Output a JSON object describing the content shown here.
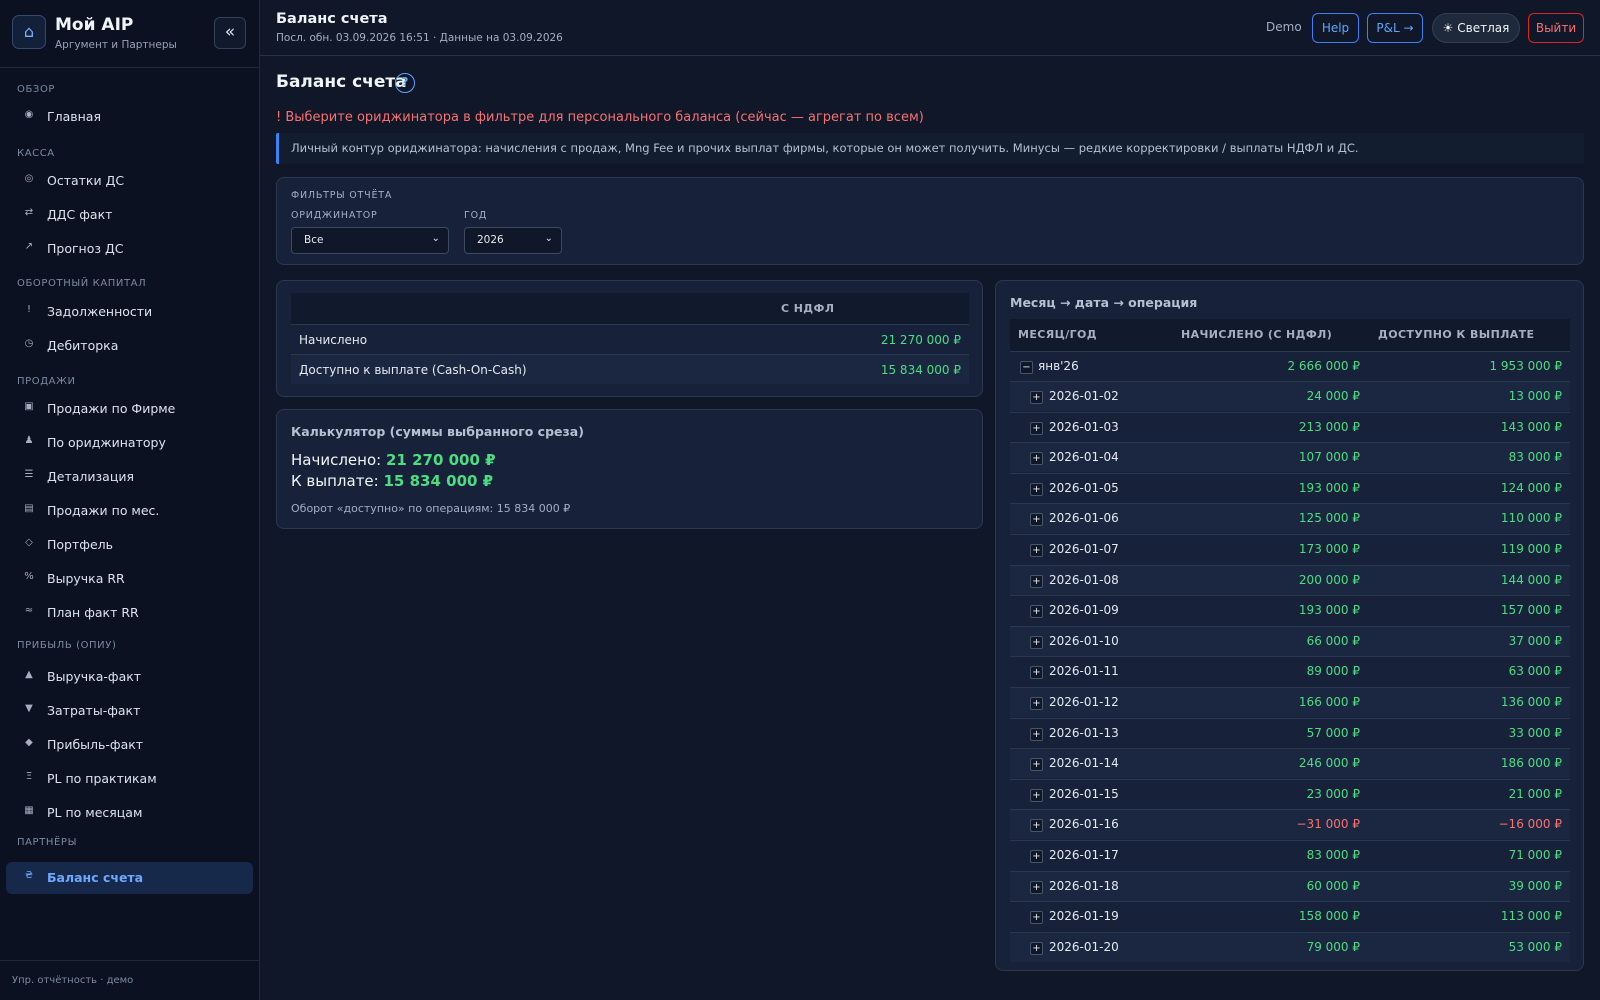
{
  "brand": {
    "logo_icon": "home-icon",
    "title": "Мой AIP",
    "subtitle": "Аргумент и Партнеры",
    "collapse": "«"
  },
  "sidebar": {
    "sections": [
      {
        "title": "ОБЗОР",
        "items": [
          {
            "icon": "◉",
            "label": "Главная"
          }
        ]
      },
      {
        "title": "КАССА",
        "items": [
          {
            "icon": "◎",
            "label": "Остатки ДС"
          },
          {
            "icon": "⇄",
            "label": "ДДС факт"
          },
          {
            "icon": "↗",
            "label": "Прогноз ДС"
          }
        ]
      },
      {
        "title": "ОБОРОТНЫЙ КАПИТАЛ",
        "items": [
          {
            "icon": "!",
            "label": "Задолженности"
          },
          {
            "icon": "◷",
            "label": "Дебиторка"
          }
        ]
      },
      {
        "title": "ПРОДАЖИ",
        "items": [
          {
            "icon": "▣",
            "label": "Продажи по Фирме"
          },
          {
            "icon": "♟",
            "label": "По ориджинатору"
          },
          {
            "icon": "☰",
            "label": "Детализация"
          },
          {
            "icon": "▤",
            "label": "Продажи по мес."
          },
          {
            "icon": "◇",
            "label": "Портфель"
          },
          {
            "icon": "%",
            "label": "Выручка RR"
          },
          {
            "icon": "≈",
            "label": "План факт RR"
          }
        ]
      },
      {
        "title": "ПРИБЫЛЬ (ОПИУ)",
        "items": [
          {
            "icon": "▲",
            "label": "Выручка-факт"
          },
          {
            "icon": "▼",
            "label": "Затраты-факт"
          },
          {
            "icon": "◆",
            "label": "Прибыль-факт"
          },
          {
            "icon": "Ξ",
            "label": "PL по практикам"
          },
          {
            "icon": "▦",
            "label": "PL по месяцам"
          }
        ]
      },
      {
        "title": "ПАРТНЁРЫ",
        "items": [
          {
            "icon": "₴",
            "label": "Баланс счета",
            "active": true
          }
        ]
      }
    ],
    "footer": "Упр. отчётность · демо"
  },
  "header": {
    "title": "Баланс счета",
    "subtitle": "Посл. обн. 03.09.2026 16:51 · Данные на 03.09.2026",
    "demo": "Demo",
    "help": "Help",
    "pl": "P&L →",
    "theme": "☀ Светлая",
    "logout": "Выйти"
  },
  "page": {
    "title": "Баланс счета",
    "help_icon": "?",
    "warning": "! Выберите ориджинатора в фильтре для персонального баланса (сейчас — агрегат по всем)",
    "info": "Личный контур ориджинатора: начисления с продаж, Mng Fee и прочих выплат фирмы, которые он может получить. Минусы — редкие корректировки / выплаты НДФЛ и ДС."
  },
  "filters": {
    "title": "ФИЛЬТРЫ ОТЧЁТА",
    "originator_label": "ОРИДЖИНАТОР",
    "originator_value": "Все",
    "year_label": "ГОД",
    "year_value": "2026"
  },
  "summary": {
    "col_header": "С НДФЛ",
    "rows": [
      {
        "label": "Начислено",
        "value": "21 270 000 ₽"
      },
      {
        "label": "Доступно к выплате (Cash-On-Cash)",
        "value": "15 834 000 ₽"
      }
    ]
  },
  "calculator": {
    "title": "Калькулятор (суммы выбранного среза)",
    "accrued_label": "Начислено:",
    "accrued_value": "21 270 000 ₽",
    "payout_label": "К выплате:",
    "payout_value": "15 834 000 ₽",
    "footer": "Оборот «доступно» по операциям: 15 834 000 ₽"
  },
  "tree": {
    "title": "Месяц → дата → операция",
    "columns": [
      "МЕСЯЦ/ГОД",
      "НАЧИСЛЕНО (С НДФЛ)",
      "ДОСТУПНО К ВЫПЛАТЕ"
    ],
    "month": {
      "toggle": "−",
      "label": "янв'26",
      "accrued": "2 666 000 ₽",
      "available": "1 953 000 ₽"
    },
    "days": [
      {
        "date": "2026-01-02",
        "accrued": "24 000 ₽",
        "available": "13 000 ₽"
      },
      {
        "date": "2026-01-03",
        "accrued": "213 000 ₽",
        "available": "143 000 ₽"
      },
      {
        "date": "2026-01-04",
        "accrued": "107 000 ₽",
        "available": "83 000 ₽"
      },
      {
        "date": "2026-01-05",
        "accrued": "193 000 ₽",
        "available": "124 000 ₽"
      },
      {
        "date": "2026-01-06",
        "accrued": "125 000 ₽",
        "available": "110 000 ₽"
      },
      {
        "date": "2026-01-07",
        "accrued": "173 000 ₽",
        "available": "119 000 ₽"
      },
      {
        "date": "2026-01-08",
        "accrued": "200 000 ₽",
        "available": "144 000 ₽"
      },
      {
        "date": "2026-01-09",
        "accrued": "193 000 ₽",
        "available": "157 000 ₽"
      },
      {
        "date": "2026-01-10",
        "accrued": "66 000 ₽",
        "available": "37 000 ₽"
      },
      {
        "date": "2026-01-11",
        "accrued": "89 000 ₽",
        "available": "63 000 ₽"
      },
      {
        "date": "2026-01-12",
        "accrued": "166 000 ₽",
        "available": "136 000 ₽"
      },
      {
        "date": "2026-01-13",
        "accrued": "57 000 ₽",
        "available": "33 000 ₽"
      },
      {
        "date": "2026-01-14",
        "accrued": "246 000 ₽",
        "available": "186 000 ₽"
      },
      {
        "date": "2026-01-15",
        "accrued": "23 000 ₽",
        "available": "21 000 ₽"
      },
      {
        "date": "2026-01-16",
        "accrued": "−31 000 ₽",
        "available": "−16 000 ₽",
        "negative": true
      },
      {
        "date": "2026-01-17",
        "accrued": "83 000 ₽",
        "available": "71 000 ₽"
      },
      {
        "date": "2026-01-18",
        "accrued": "60 000 ₽",
        "available": "39 000 ₽"
      },
      {
        "date": "2026-01-19",
        "accrued": "158 000 ₽",
        "available": "113 000 ₽"
      },
      {
        "date": "2026-01-20",
        "accrued": "79 000 ₽",
        "available": "53 000 ₽"
      }
    ],
    "day_toggle": "+"
  },
  "colors": {
    "accent": "#3b82f6",
    "positive": "#4ade80",
    "negative": "#f87171",
    "background": "#0f1728"
  }
}
